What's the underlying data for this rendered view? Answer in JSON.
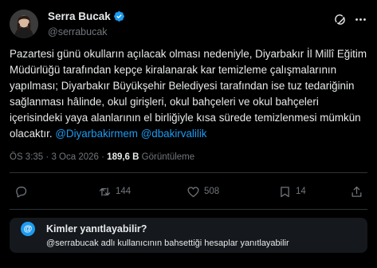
{
  "author": {
    "display_name": "Serra Bucak",
    "handle": "@serrabucak",
    "verified": true,
    "verified_color": "#1d9bf0"
  },
  "tweet": {
    "text": "Pazartesi günü okulların açılacak olması nedeniyle, Diyarbakır İl Millî Eğitim Müdürlüğü tarafından kepçe kiralanarak kar temizleme çalışmalarının yapılması; Diyarbakır Büyükşehir Belediyesi tarafından ise tuz tedariğinin sağlanması hâlinde, okul girişleri, okul bahçeleri ve okul bahçeleri içerisindeki yaya alanlarının el birliğiyle kısa sürede temizlenmesi mümkün olacaktır.",
    "mentions": [
      "@Diyarbakirmem",
      "@dbakirvalilik"
    ],
    "mention_color": "#1d9bf0"
  },
  "meta": {
    "time": "ÖS 3:35",
    "separator": "·",
    "date": "3 Oca 2026",
    "views_count": "189,6 B",
    "views_label": "Görüntüleme"
  },
  "actions": {
    "reply_count": "",
    "retweet_count": "144",
    "like_count": "508",
    "bookmark_count": "14"
  },
  "reply_restriction": {
    "icon_glyph": "@",
    "title": "Kimler yanıtlayabilir?",
    "description": "@serrabucak adlı kullanıcının bahsettiği hesaplar yanıtlayabilir"
  }
}
